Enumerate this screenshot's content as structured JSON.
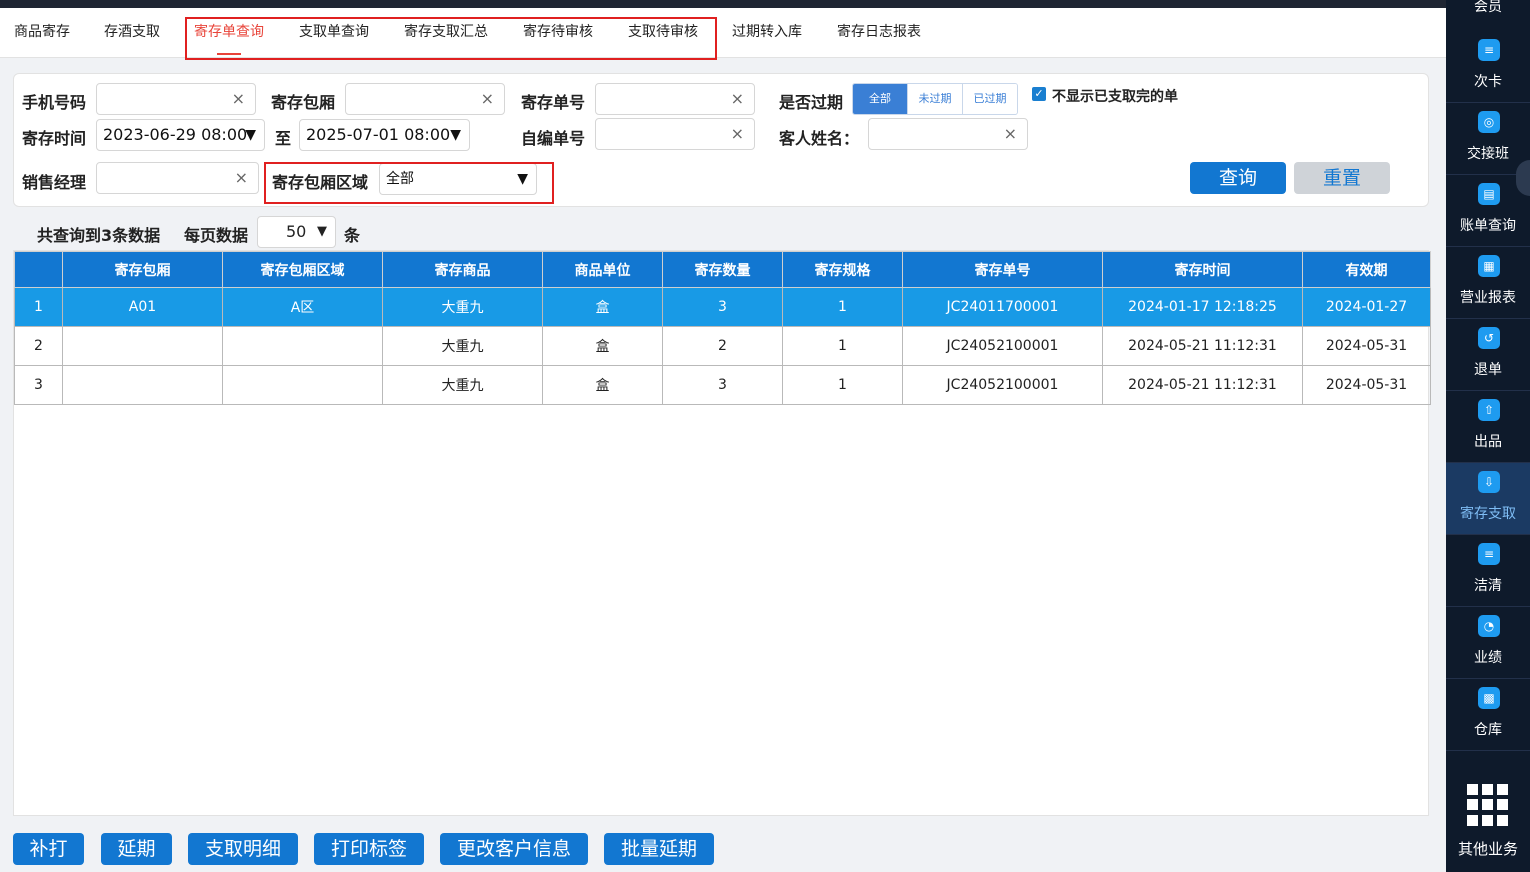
{
  "tabs": [
    "商品寄存",
    "存酒支取",
    "寄存单查询",
    "支取单查询",
    "寄存支取汇总",
    "寄存待审核",
    "支取待审核",
    "过期转入库",
    "寄存日志报表"
  ],
  "filters": {
    "phone_label": "手机号码",
    "room_label": "寄存包厢",
    "order_no_label": "寄存单号",
    "expired_label": "是否过期",
    "expired_options": [
      "全部",
      "未过期",
      "已过期"
    ],
    "hide_done_label": "不显示已支取完的单",
    "time_label": "寄存时间",
    "time_start": "2023-06-29 08:00",
    "to_label": "至",
    "time_end": "2025-07-01 08:00",
    "self_no_label": "自编单号",
    "guest_label": "客人姓名：",
    "manager_label": "销售经理",
    "area_label": "寄存包厢区域",
    "area_value": "全部",
    "clear_glyph": "×",
    "dropdown_glyph": "▼"
  },
  "actions": {
    "query": "查询",
    "reset": "重置"
  },
  "summary": {
    "total": "共查询到3条数据",
    "page_size_label": "每页数据",
    "page_size": "50",
    "unit": "条"
  },
  "table": {
    "headers": [
      "",
      "寄存包厢",
      "寄存包厢区域",
      "寄存商品",
      "商品单位",
      "寄存数量",
      "寄存规格",
      "寄存单号",
      "寄存时间",
      "有效期"
    ],
    "rows": [
      [
        "1",
        "A01",
        "A区",
        "大重九",
        "盒",
        "3",
        "1",
        "JC24011700001",
        "2024-01-17 12:18:25",
        "2024-01-27"
      ],
      [
        "2",
        "",
        "",
        "大重九",
        "盒",
        "2",
        "1",
        "JC24052100001",
        "2024-05-21 11:12:31",
        "2024-05-31"
      ],
      [
        "3",
        "",
        "",
        "大重九",
        "盒",
        "3",
        "1",
        "JC24052100001",
        "2024-05-21 11:12:31",
        "2024-05-31"
      ]
    ]
  },
  "bottom_buttons": [
    "补打",
    "延期",
    "支取明细",
    "打印标签",
    "更改客户信息",
    "批量延期"
  ],
  "sidebar": {
    "top_partial": "会员",
    "items": [
      "次卡",
      "交接班",
      "账单查询",
      "营业报表",
      "退单",
      "出品",
      "寄存支取",
      "洁清",
      "业绩",
      "仓库"
    ],
    "other": "其他业务"
  },
  "colors": {
    "primary": "#1277d1",
    "selected_row": "#189ae6",
    "active_tab": "#e8443a",
    "highlight_box": "#e02020"
  }
}
